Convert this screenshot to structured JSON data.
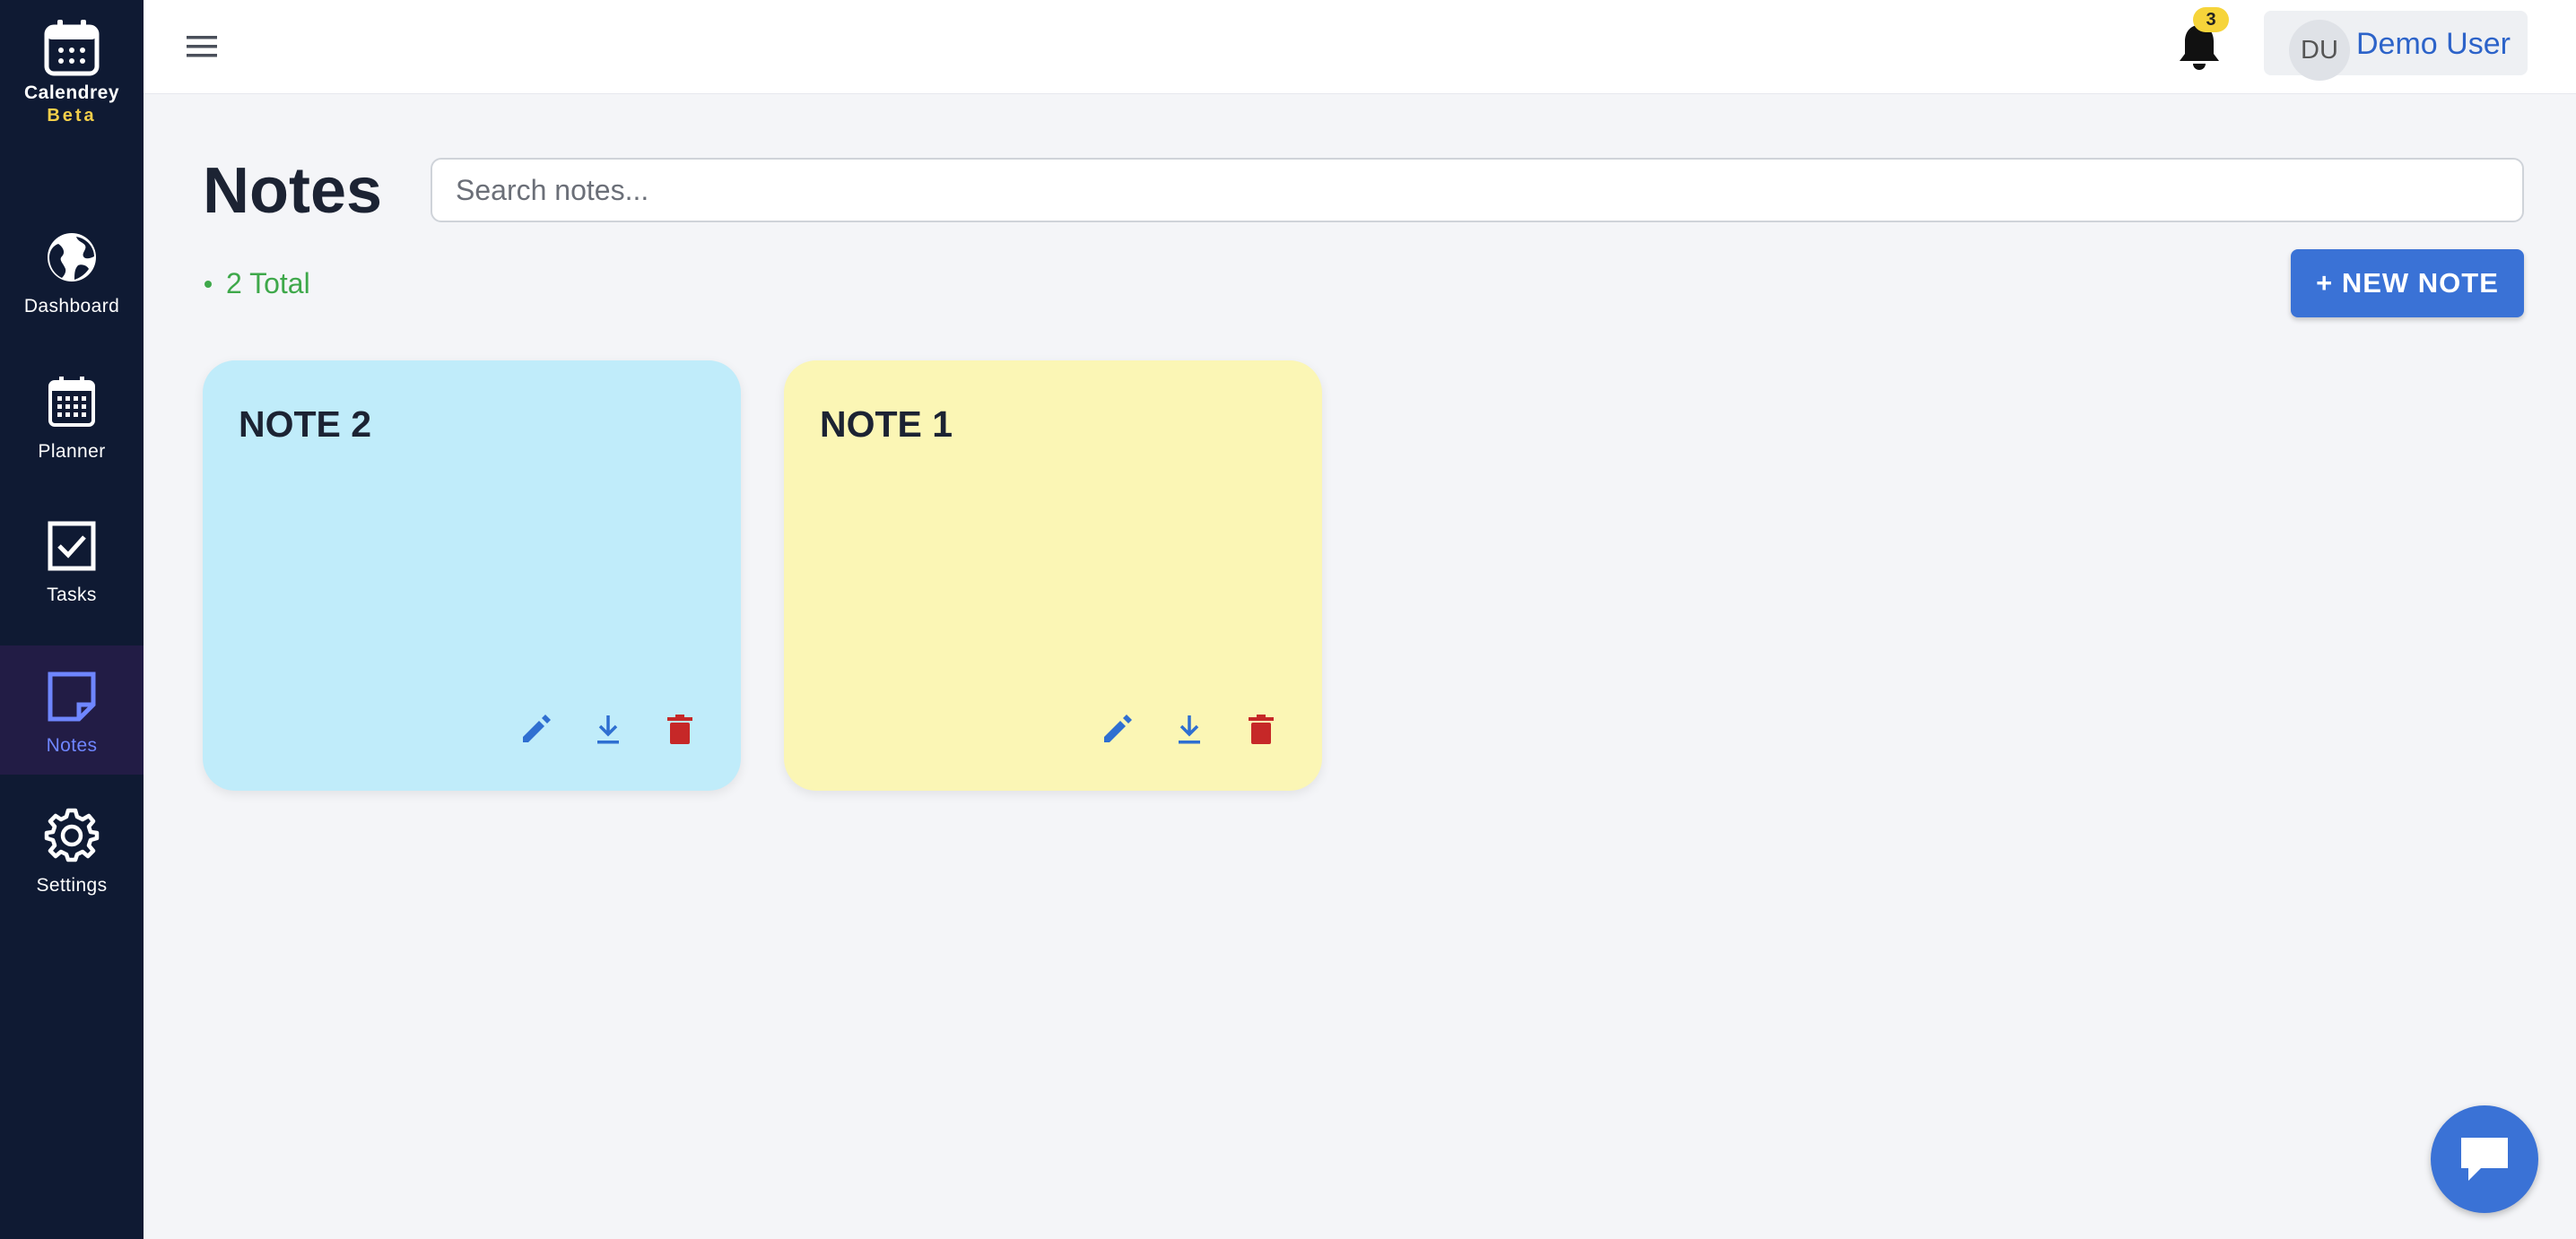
{
  "brand": {
    "name": "Calendrey",
    "tag": "Beta"
  },
  "sidebar": {
    "items": [
      {
        "label": "Dashboard",
        "icon": "globe-icon"
      },
      {
        "label": "Planner",
        "icon": "calendar-icon"
      },
      {
        "label": "Tasks",
        "icon": "checkbox-icon"
      },
      {
        "label": "Notes",
        "icon": "note-icon",
        "active": true
      },
      {
        "label": "Settings",
        "icon": "gear-icon"
      }
    ]
  },
  "header": {
    "notification_count": "3",
    "user": {
      "initials": "DU",
      "name": "Demo User"
    }
  },
  "main": {
    "title": "Notes",
    "search": {
      "placeholder": "Search notes...",
      "value": ""
    },
    "total_label": "2 Total",
    "new_note_label": "+ NEW NOTE",
    "notes": [
      {
        "title": "NOTE 2",
        "color": "#c0ecfa"
      },
      {
        "title": "NOTE 1",
        "color": "#fbf6b5"
      }
    ]
  },
  "colors": {
    "sidebar_bg": "#0f1a33",
    "accent": "#3a72d6",
    "active_nav": "#6f86ff",
    "total_green": "#3ea84a",
    "delete_red": "#c62828",
    "badge_yellow": "#f6d43a"
  }
}
